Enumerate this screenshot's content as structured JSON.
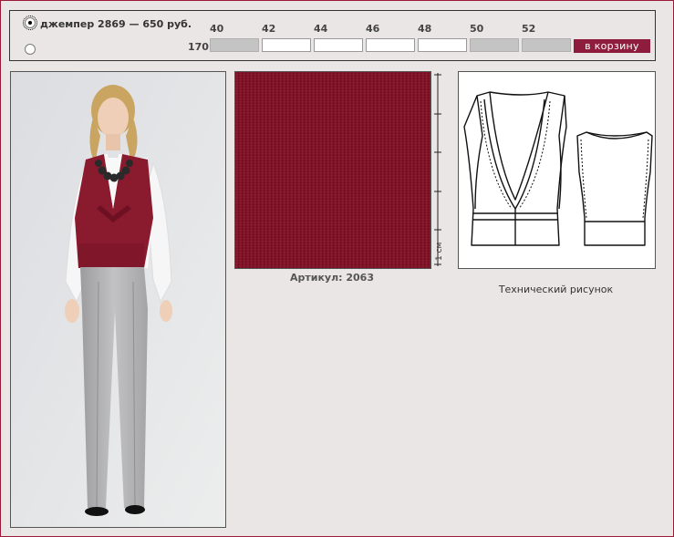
{
  "product": {
    "label": "джемпер  2869 — 650 руб."
  },
  "sizes": {
    "headers": [
      "40",
      "42",
      "44",
      "46",
      "48",
      "50",
      "52"
    ],
    "height": "170",
    "availability": [
      false,
      true,
      true,
      true,
      true,
      false,
      false
    ]
  },
  "cart_button": "в корзину",
  "article": "Артикул: 2063",
  "ruler_label": "1 см",
  "tech_caption": "Технический рисунок",
  "colors": {
    "accent": "#8e1d3d",
    "fabric": "#80142a",
    "background": "#ebe6e6"
  }
}
